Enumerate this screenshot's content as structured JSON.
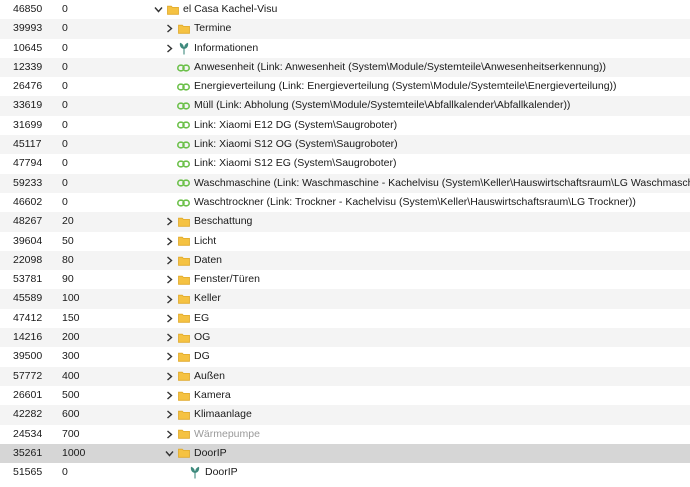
{
  "tree": {
    "rows": [
      {
        "id": "46850",
        "pos": "0",
        "name": "el Casa Kachel-Visu",
        "depth": 0,
        "icon": "folder-icon",
        "chevron": "chevron-down-icon"
      },
      {
        "id": "39993",
        "pos": "0",
        "name": "Termine",
        "depth": 1,
        "icon": "folder-icon",
        "chevron": "chevron-right-icon"
      },
      {
        "id": "10645",
        "pos": "0",
        "name": "Informationen",
        "depth": 1,
        "icon": "plant-icon",
        "chevron": "chevron-right-icon"
      },
      {
        "id": "12339",
        "pos": "0",
        "name": "Anwesenheit (Link: Anwesenheit (System\\Module/Systemteile\\Anwesenheitserkennung))",
        "depth": 1,
        "icon": "link-icon",
        "chevron": ""
      },
      {
        "id": "26476",
        "pos": "0",
        "name": "Energieverteilung (Link: Energieverteilung (System\\Module/Systemteile\\Energieverteilung))",
        "depth": 1,
        "icon": "link-icon",
        "chevron": ""
      },
      {
        "id": "33619",
        "pos": "0",
        "name": "Müll (Link: Abholung (System\\Module/Systemteile\\Abfallkalender\\Abfallkalender))",
        "depth": 1,
        "icon": "link-icon",
        "chevron": ""
      },
      {
        "id": "31699",
        "pos": "0",
        "name": "Link: Xiaomi E12 DG (System\\Saugroboter)",
        "depth": 1,
        "icon": "link-icon",
        "chevron": ""
      },
      {
        "id": "45117",
        "pos": "0",
        "name": "Link: Xiaomi S12 OG (System\\Saugroboter)",
        "depth": 1,
        "icon": "link-icon",
        "chevron": ""
      },
      {
        "id": "47794",
        "pos": "0",
        "name": "Link: Xiaomi S12 EG (System\\Saugroboter)",
        "depth": 1,
        "icon": "link-icon",
        "chevron": ""
      },
      {
        "id": "59233",
        "pos": "0",
        "name": "Waschmaschine (Link: Waschmaschine - Kachelvisu (System\\Keller\\Hauswirtschaftsraum\\LG Waschmaschine))",
        "depth": 1,
        "icon": "link-icon",
        "chevron": ""
      },
      {
        "id": "46602",
        "pos": "0",
        "name": "Waschtrockner (Link: Trockner - Kachelvisu (System\\Keller\\Hauswirtschaftsraum\\LG Trockner))",
        "depth": 1,
        "icon": "link-icon",
        "chevron": ""
      },
      {
        "id": "48267",
        "pos": "20",
        "name": "Beschattung",
        "depth": 1,
        "icon": "folder-icon",
        "chevron": "chevron-right-icon"
      },
      {
        "id": "39604",
        "pos": "50",
        "name": "Licht",
        "depth": 1,
        "icon": "folder-icon",
        "chevron": "chevron-right-icon"
      },
      {
        "id": "22098",
        "pos": "80",
        "name": "Daten",
        "depth": 1,
        "icon": "folder-icon",
        "chevron": "chevron-right-icon"
      },
      {
        "id": "53781",
        "pos": "90",
        "name": "Fenster/Türen",
        "depth": 1,
        "icon": "folder-icon",
        "chevron": "chevron-right-icon"
      },
      {
        "id": "45589",
        "pos": "100",
        "name": "Keller",
        "depth": 1,
        "icon": "folder-icon",
        "chevron": "chevron-right-icon"
      },
      {
        "id": "47412",
        "pos": "150",
        "name": "EG",
        "depth": 1,
        "icon": "folder-icon",
        "chevron": "chevron-right-icon"
      },
      {
        "id": "14216",
        "pos": "200",
        "name": "OG",
        "depth": 1,
        "icon": "folder-icon",
        "chevron": "chevron-right-icon"
      },
      {
        "id": "39500",
        "pos": "300",
        "name": "DG",
        "depth": 1,
        "icon": "folder-icon",
        "chevron": "chevron-right-icon"
      },
      {
        "id": "57772",
        "pos": "400",
        "name": "Außen",
        "depth": 1,
        "icon": "folder-icon",
        "chevron": "chevron-right-icon"
      },
      {
        "id": "26601",
        "pos": "500",
        "name": "Kamera",
        "depth": 1,
        "icon": "folder-icon",
        "chevron": "chevron-right-icon"
      },
      {
        "id": "42282",
        "pos": "600",
        "name": "Klimaanlage",
        "depth": 1,
        "icon": "folder-icon",
        "chevron": "chevron-right-icon"
      },
      {
        "id": "24534",
        "pos": "700",
        "name": "Wärmepumpe",
        "depth": 1,
        "icon": "folder-icon",
        "chevron": "chevron-right-icon",
        "disabled": true
      },
      {
        "id": "35261",
        "pos": "1000",
        "name": "DoorIP",
        "depth": 1,
        "icon": "folder-icon",
        "chevron": "chevron-down-icon",
        "selected": true
      },
      {
        "id": "51565",
        "pos": "0",
        "name": "DoorIP",
        "depth": 2,
        "icon": "plant-icon",
        "chevron": ""
      }
    ]
  },
  "colors": {
    "folder": "#f5c242",
    "folder_dark": "#e0a92a",
    "link": "#6cc04a",
    "plant": "#3f8a7d",
    "chevron": "#333333",
    "selected_row": "#d6d6d6",
    "zebra_row": "#f4f4f4"
  }
}
